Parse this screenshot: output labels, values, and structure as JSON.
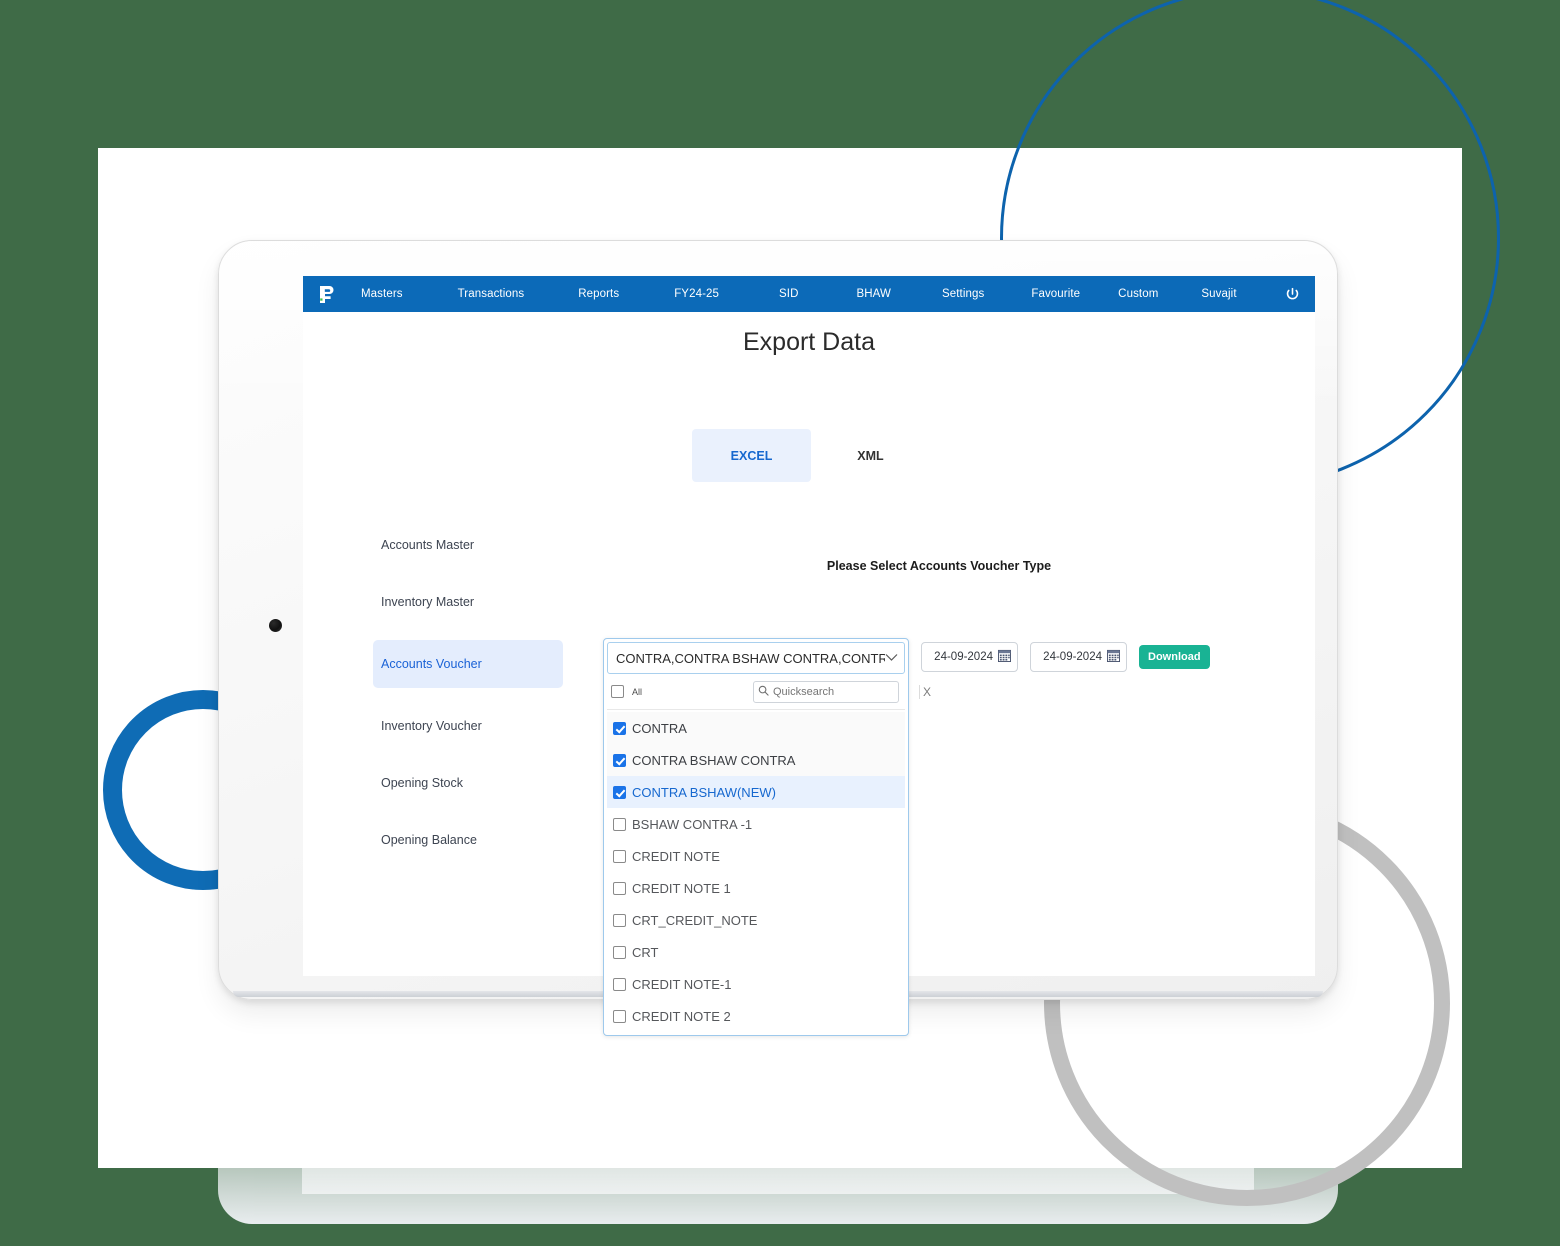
{
  "navbar": {
    "logo_icon": "brand-logo-icon",
    "items": [
      {
        "label": "Masters"
      },
      {
        "label": "Transactions"
      },
      {
        "label": "Reports"
      },
      {
        "label": "FY24-25"
      },
      {
        "label": "SID"
      },
      {
        "label": "BHAW"
      },
      {
        "label": "Settings"
      },
      {
        "label": "Favourite"
      },
      {
        "label": "Custom"
      },
      {
        "label": "Suvajit"
      }
    ],
    "power_icon": "power-icon",
    "background": "#0c6ab8"
  },
  "page": {
    "title": "Export Data",
    "section_caption": "Please Select Accounts Voucher Type"
  },
  "format_tabs": [
    {
      "label": "EXCEL",
      "active": true
    },
    {
      "label": "XML",
      "active": false
    }
  ],
  "entities": [
    {
      "label": "Accounts Master",
      "active": false
    },
    {
      "label": "Inventory Master",
      "active": false
    },
    {
      "label": "Accounts Voucher",
      "active": true
    },
    {
      "label": "Inventory Voucher",
      "active": false
    },
    {
      "label": "Opening Stock",
      "active": false
    },
    {
      "label": "Opening Balance",
      "active": false
    }
  ],
  "controls": {
    "from_date": "24-09-2024",
    "to_date": "24-09-2024",
    "calendar_icon": "calendar-icon",
    "download_label": "Download",
    "download_color": "#19b394"
  },
  "multiselect": {
    "selected_text": "CONTRA,CONTRA BSHAW CONTRA,CONTRA BS",
    "chevron_icon": "chevron-down-icon",
    "all_label": "All",
    "all_checked": false,
    "search_icon": "search-icon",
    "search_value": "",
    "search_placeholder": "Quicksearch",
    "clear_label": "X",
    "options": [
      {
        "label": "CONTRA",
        "checked": true,
        "state": "sel"
      },
      {
        "label": "CONTRA BSHAW CONTRA",
        "checked": true,
        "state": "sel"
      },
      {
        "label": "CONTRA BSHAW(NEW)",
        "checked": true,
        "state": "hl"
      },
      {
        "label": "BSHAW CONTRA -1",
        "checked": false,
        "state": ""
      },
      {
        "label": "CREDIT NOTE",
        "checked": false,
        "state": ""
      },
      {
        "label": "CREDIT NOTE 1",
        "checked": false,
        "state": ""
      },
      {
        "label": "CRT_CREDIT_NOTE",
        "checked": false,
        "state": ""
      },
      {
        "label": "CRT",
        "checked": false,
        "state": ""
      },
      {
        "label": "CREDIT NOTE-1",
        "checked": false,
        "state": ""
      },
      {
        "label": "CREDIT NOTE 2",
        "checked": false,
        "state": ""
      }
    ]
  },
  "decor": {
    "background_color": "#3f6b47",
    "ring_blue": "#0d63ad",
    "ring_blue_thick": "#0f6cb5",
    "ring_grey": "#c0c0c0"
  }
}
